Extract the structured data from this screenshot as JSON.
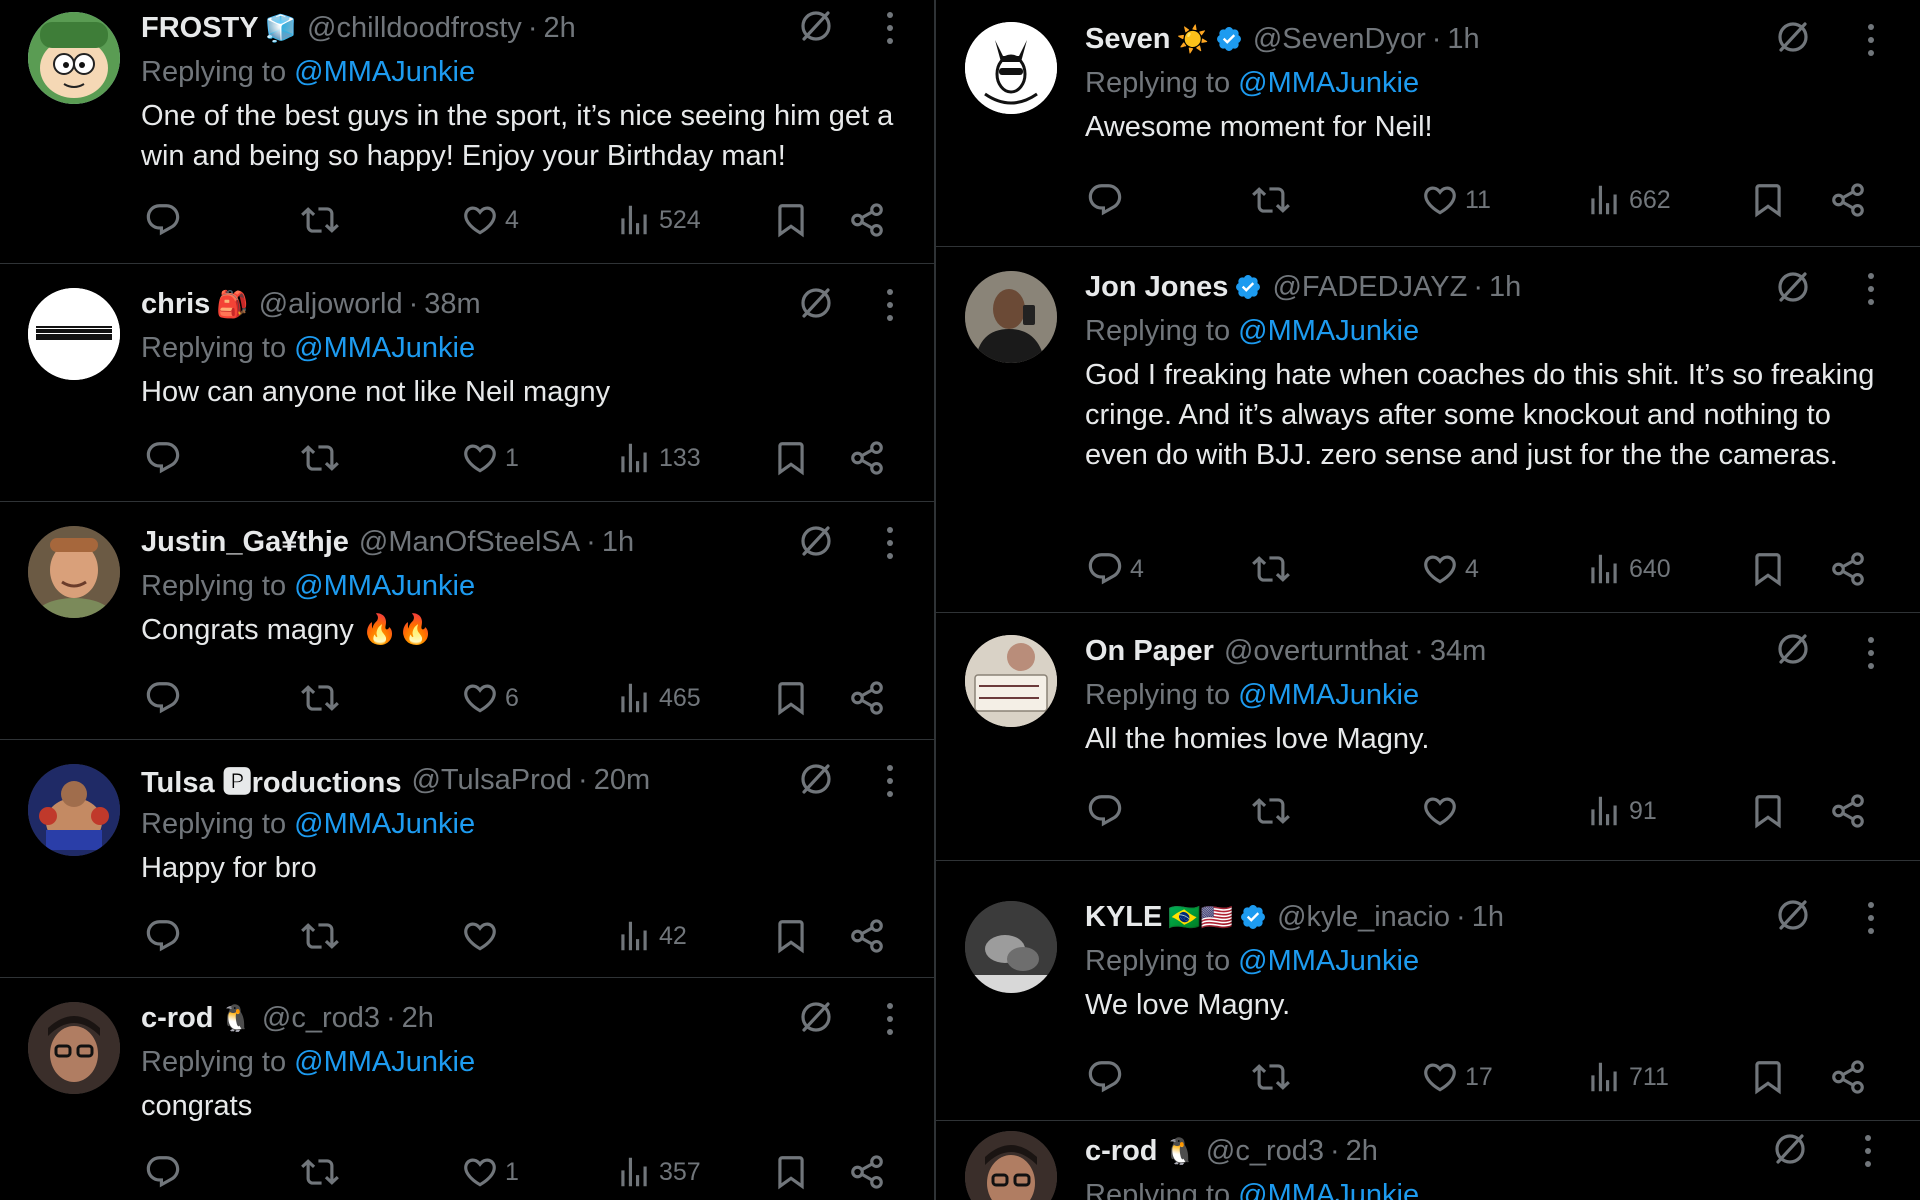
{
  "reply_prefix": "Replying to",
  "left_tweets": [
    {
      "name": "FROSTY",
      "emoji": "🧊",
      "verified": false,
      "handle": "@chilldoodfrosty",
      "time": "2h",
      "mention": "@MMAJunkie",
      "text": "One of the best guys in the sport, it’s nice seeing him get a win and being so happy! Enjoy your Birthday man!",
      "replies": "",
      "likes": "4",
      "views": "524",
      "avatar": "cartoon-face"
    },
    {
      "name": "chris",
      "emoji": "🎒",
      "verified": false,
      "handle": "@aljoworld",
      "time": "38m",
      "mention": "@MMAJunkie",
      "text": "How can anyone not like Neil magny",
      "replies": "",
      "likes": "1",
      "views": "133",
      "avatar": "I AM MUSIC"
    },
    {
      "name": "Justin_Ga¥thje",
      "emoji": "",
      "verified": false,
      "handle": "@ManOfSteelSA",
      "time": "1h",
      "mention": "@MMAJunkie",
      "text": "Congrats magny 🔥🔥",
      "replies": "",
      "likes": "6",
      "views": "465",
      "avatar": "photo-man"
    },
    {
      "name": "Tulsa 🅿roductions",
      "emoji": "",
      "verified": false,
      "handle": "@TulsaProd",
      "time": "20m",
      "mention": "@MMAJunkie",
      "text": "Happy for bro",
      "replies": "",
      "likes": "",
      "views": "42",
      "avatar": "photo-fighter"
    },
    {
      "name": "c-rod",
      "emoji": "🐧",
      "verified": false,
      "handle": "@c_rod3",
      "time": "2h",
      "mention": "@MMAJunkie",
      "text": "congrats",
      "replies": "",
      "likes": "1",
      "views": "357",
      "avatar": "photo-glasses"
    }
  ],
  "right_tweets": [
    {
      "name": "Seven",
      "emoji": "☀️",
      "verified": true,
      "handle": "@SevenDyor",
      "time": "1h",
      "mention": "@MMAJunkie",
      "text": "Awesome moment for Neil!",
      "replies": "",
      "likes": "11",
      "views": "662",
      "avatar": "I'M SEVEN"
    },
    {
      "name": "Jon Jones",
      "emoji": "",
      "verified": true,
      "handle": "@FADEDJAYZ",
      "time": "1h",
      "mention": "@MMAJunkie",
      "text": "God I freaking hate when coaches do this shit. It’s so freaking cringe. And it’s always after some knockout and nothing to even do with BJJ. zero sense and just for the the cameras.",
      "replies": "4",
      "likes": "4",
      "views": "640",
      "avatar": "photo-selfie"
    },
    {
      "name": "On Paper",
      "emoji": "",
      "verified": false,
      "handle": "@overturnthat",
      "time": "34m",
      "mention": "@MMAJunkie",
      "text": "All the homies love Magny.",
      "replies": "",
      "likes": "",
      "views": "91",
      "avatar": "PLEASE BE VERY PATIENT"
    },
    {
      "name": "KYLE",
      "emoji": "🇧🇷🇺🇸",
      "verified": true,
      "handle": "@kyle_inacio",
      "time": "1h",
      "mention": "@MMAJunkie",
      "text": "We love Magny.",
      "replies": "",
      "likes": "17",
      "views": "711",
      "avatar": "photo-fight"
    },
    {
      "name": "c-rod",
      "emoji": "🐧",
      "verified": false,
      "handle": "@c_rod3",
      "time": "2h",
      "mention": "@MMAJunkie",
      "text": "",
      "replies": "",
      "likes": "",
      "views": "",
      "avatar": "photo-glasses"
    }
  ],
  "colors": {
    "background": "#000000",
    "text": "#e7e9ea",
    "muted": "#71767b",
    "link": "#1d9bf0",
    "verified": "#1d9bf0",
    "divider": "#2f3336"
  },
  "icons": [
    "grok-icon",
    "more-icon",
    "reply-icon",
    "retweet-icon",
    "like-icon",
    "views-icon",
    "bookmark-icon",
    "share-icon",
    "verified-badge-icon"
  ]
}
